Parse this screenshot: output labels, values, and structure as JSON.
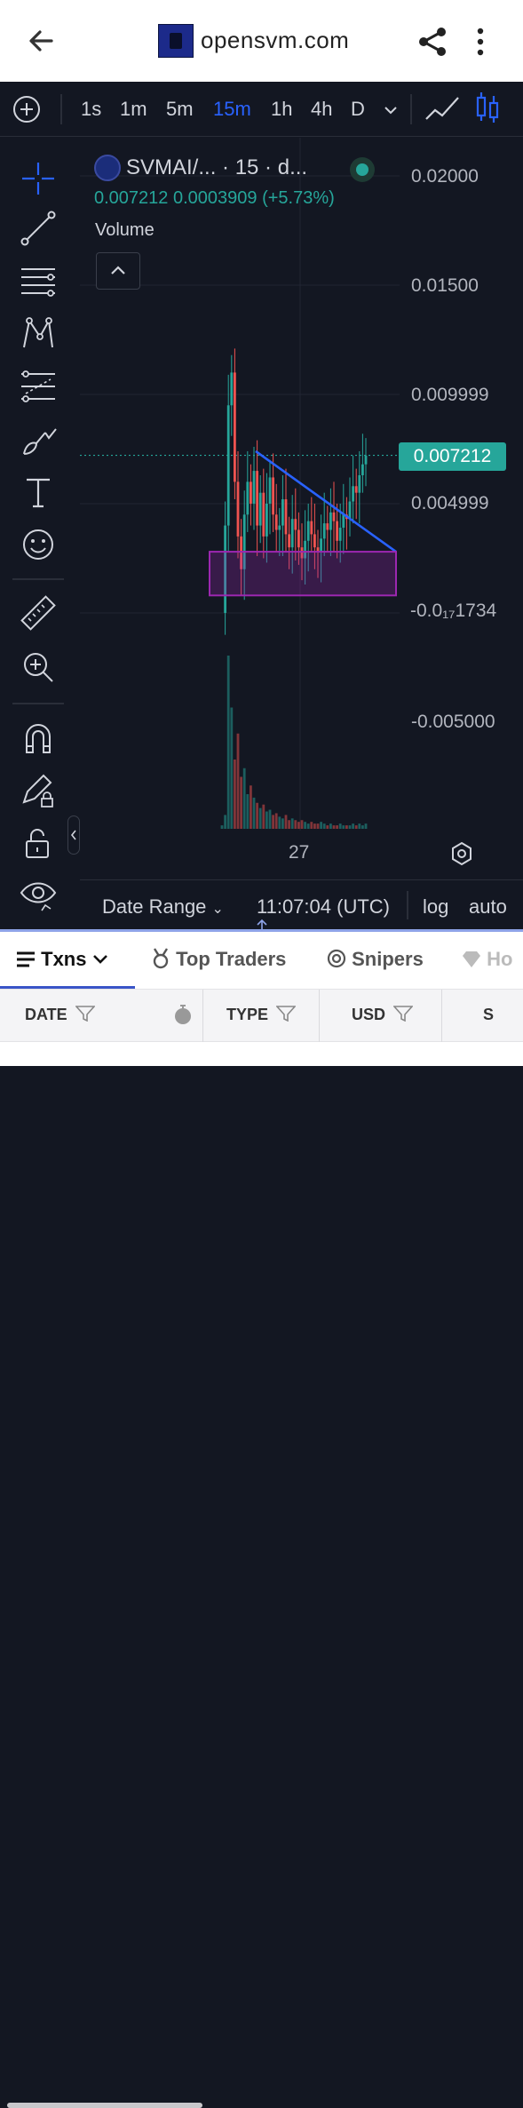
{
  "browser": {
    "url": "opensvm.com",
    "icons": [
      "back-arrow-icon",
      "site-logo",
      "share-icon",
      "more-vert-icon"
    ]
  },
  "timeframes": {
    "items": [
      "1s",
      "1m",
      "5m",
      "15m",
      "1h",
      "4h",
      "D"
    ],
    "active": "15m"
  },
  "legend": {
    "symbol": "SVMAI/...",
    "interval": "· 15 · d...",
    "ohlc": "0.007212  0.0003909 (+5.73%)",
    "volume_label": "Volume"
  },
  "price_axis": {
    "labels": [
      "0.02000",
      "0.01500",
      "0.009999",
      "0.004999",
      "-0.0₁₇1734",
      "-0.005000"
    ],
    "last_price": "0.007212"
  },
  "time_axis": {
    "labels": [
      "27"
    ]
  },
  "bottom_bar": {
    "date_range": "Date Range",
    "time": "11:07:04 (UTC)",
    "log": "log",
    "auto": "auto"
  },
  "tabs": [
    {
      "label": "Txns",
      "icon": "list-icon",
      "active": true
    },
    {
      "label": "Top Traders",
      "icon": "medal-icon"
    },
    {
      "label": "Snipers",
      "icon": "target-icon"
    },
    {
      "label": "Ho",
      "icon": "diamond-icon"
    }
  ],
  "table": {
    "headers": [
      "DATE",
      "TYPE",
      "USD",
      "S"
    ]
  },
  "colors": {
    "up": "#26a69a",
    "down": "#ef5350",
    "accent": "#2962ff",
    "trendline": "#2962ff",
    "zone": "#9c27b0"
  },
  "chart_data": {
    "type": "candlestick",
    "symbol": "SVMAI/...",
    "interval": "15",
    "y_axis_labels": [
      0.02,
      0.015,
      0.009999,
      0.004999,
      -0.005
    ],
    "last_price": 0.007212,
    "change": 0.0003909,
    "change_pct": 5.73,
    "x_axis_labels": [
      "27"
    ],
    "close_series": [
      0.0,
      0.004,
      0.0095,
      0.011,
      0.006,
      0.0035,
      0.002,
      0.0045,
      0.006,
      0.005,
      0.0065,
      0.004,
      0.0055,
      0.0035,
      0.005,
      0.0062,
      0.0045,
      0.0038,
      0.004,
      0.0052,
      0.0036,
      0.003,
      0.0043,
      0.0038,
      0.003,
      0.0025,
      0.0033,
      0.0042,
      0.0036,
      0.003,
      0.0028,
      0.0034,
      0.0041,
      0.0038,
      0.0046,
      0.0042,
      0.0033,
      0.0039,
      0.0045,
      0.0043,
      0.0051,
      0.0058,
      0.0055,
      0.0063,
      0.0068,
      0.0072
    ],
    "volume_series": [
      2,
      8,
      100,
      70,
      40,
      55,
      30,
      35,
      20,
      25,
      18,
      15,
      12,
      14,
      10,
      11,
      8,
      9,
      7,
      6,
      8,
      5,
      6,
      5,
      4,
      5,
      4,
      3,
      4,
      3,
      3,
      4,
      3,
      2,
      3,
      2,
      2,
      3,
      2,
      2,
      2,
      3,
      2,
      3,
      2,
      3
    ],
    "trendline": {
      "from": {
        "bar": 12,
        "price": 0.0074
      },
      "to": {
        "bar": 58,
        "price": 0.0028
      }
    },
    "support_zone": {
      "price_top": 0.0028,
      "price_bottom": 0.0008
    }
  }
}
